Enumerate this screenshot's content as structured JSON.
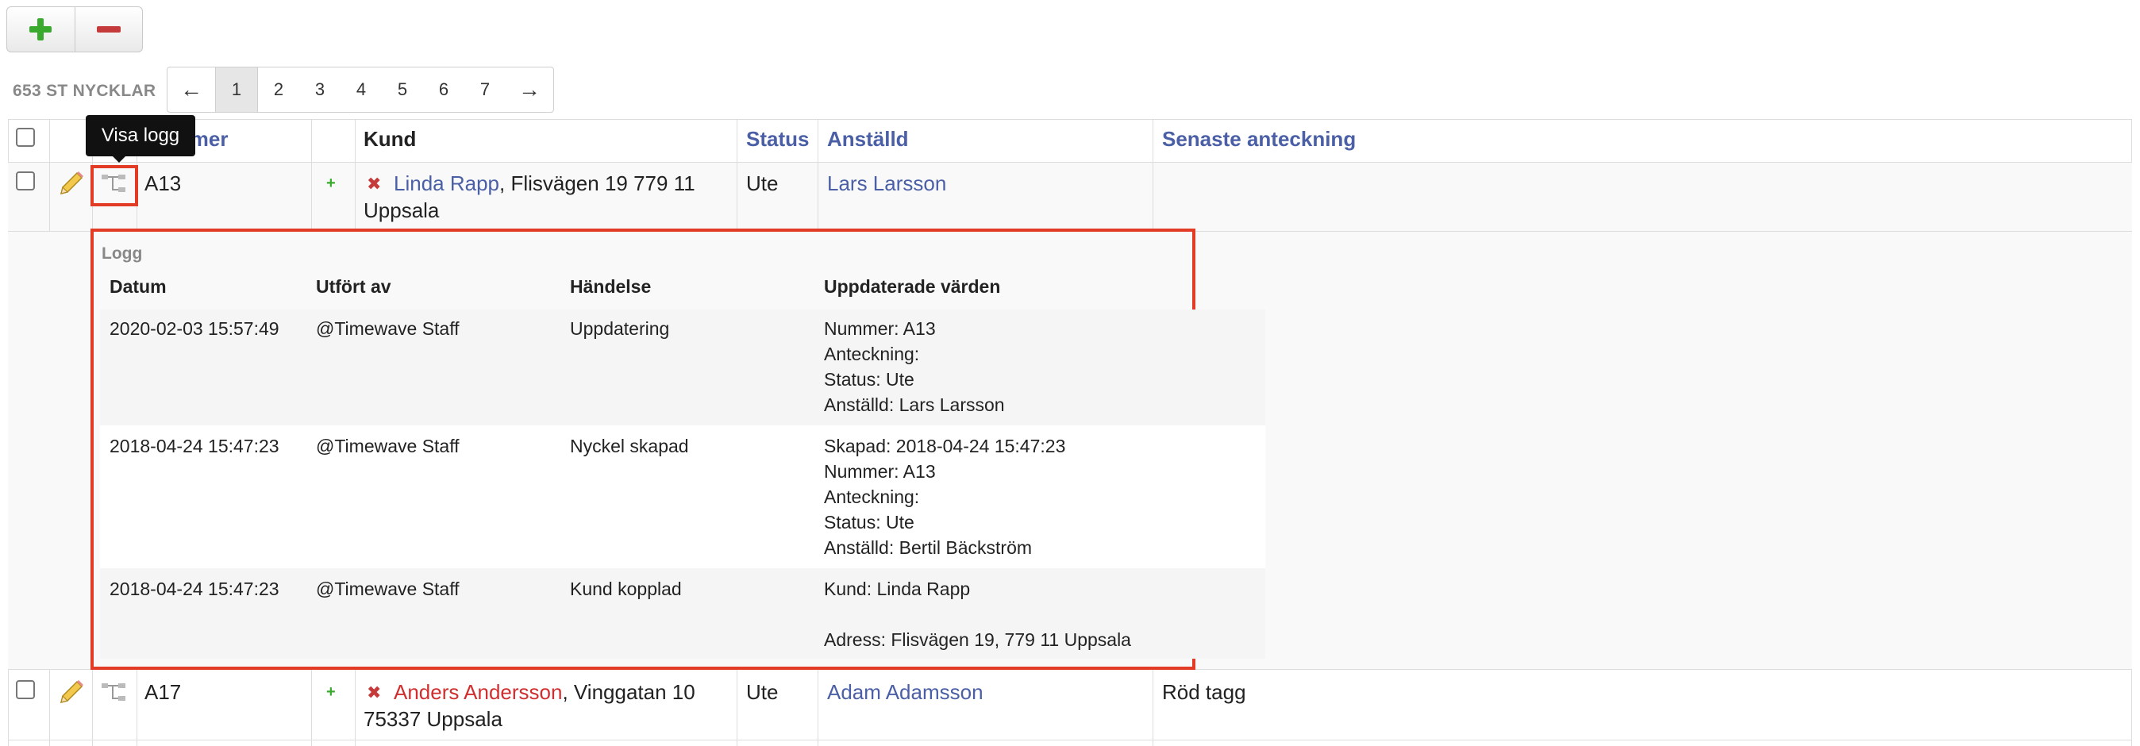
{
  "toolbar": {
    "add_icon": "plus-icon",
    "remove_icon": "minus-icon"
  },
  "count_label": "653 ST NYCKLAR",
  "pagination": {
    "prev": "←",
    "pages": [
      "1",
      "2",
      "3",
      "4",
      "5",
      "6",
      "7"
    ],
    "active": "1",
    "next": "→"
  },
  "tooltip": "Visa logg",
  "table": {
    "headers": {
      "nummer": "Nummer",
      "kund": "Kund",
      "status": "Status",
      "anstalld": "Anställd",
      "senaste": "Senaste anteckning"
    },
    "rows": [
      {
        "nummer": "A13",
        "kund_name": "Linda Rapp",
        "kund_addr_1": ", Flisvägen 19 779 11",
        "kund_addr_2": "Uppsala",
        "status": "Ute",
        "anstalld": "Lars Larsson",
        "senaste": ""
      },
      {
        "nummer": "A17",
        "kund_name": "Anders Andersson",
        "kund_addr_1": ", Vinggatan 10",
        "kund_addr_2": "75337 Uppsala",
        "status": "Ute",
        "anstalld": "Adam Adamsson",
        "senaste": "Röd tagg"
      }
    ]
  },
  "log": {
    "title": "Logg",
    "headers": {
      "datum": "Datum",
      "utfort": "Utfört av",
      "handelse": "Händelse",
      "uppdaterade": "Uppdaterade värden"
    },
    "entries": [
      {
        "datum": "2020-02-03 15:57:49",
        "utfort": "@Timewave Staff",
        "handelse": "Uppdatering",
        "values": "Nummer: A13\nAnteckning:\nStatus: Ute\nAnställd: Lars Larsson"
      },
      {
        "datum": "2018-04-24 15:47:23",
        "utfort": "@Timewave Staff",
        "handelse": "Nyckel skapad",
        "values": "Skapad: 2018-04-24 15:47:23\nNummer: A13\nAnteckning:\nStatus: Ute\nAnställd: Bertil Bäckström"
      },
      {
        "datum": "2018-04-24 15:47:23",
        "utfort": "@Timewave Staff",
        "handelse": "Kund kopplad",
        "values": "Kund: Linda Rapp\n\nAdress: Flisvägen 19, 779 11 Uppsala"
      }
    ]
  },
  "colors": {
    "link": "#4a5fa6",
    "highlight": "#e23c26",
    "customer_red": "#d12f2f"
  }
}
